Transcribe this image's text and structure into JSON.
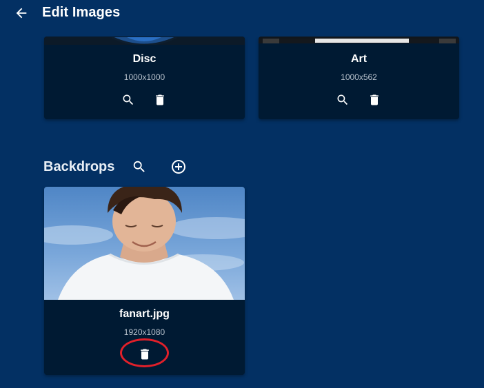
{
  "header": {
    "title": "Edit Images"
  },
  "cards_top": [
    {
      "name": "Disc",
      "dims": "1000x1000"
    },
    {
      "name": "Art",
      "dims": "1000x562"
    }
  ],
  "backdrops": {
    "title": "Backdrops",
    "items": [
      {
        "name": "fanart.jpg",
        "dims": "1920x1080"
      }
    ]
  },
  "icons": {
    "back": "arrow-left-icon",
    "search": "search-icon",
    "delete": "trash-icon",
    "add": "add-circle-icon"
  },
  "colors": {
    "background": "#033063",
    "card": "#001a33",
    "highlight": "#e0202a"
  }
}
